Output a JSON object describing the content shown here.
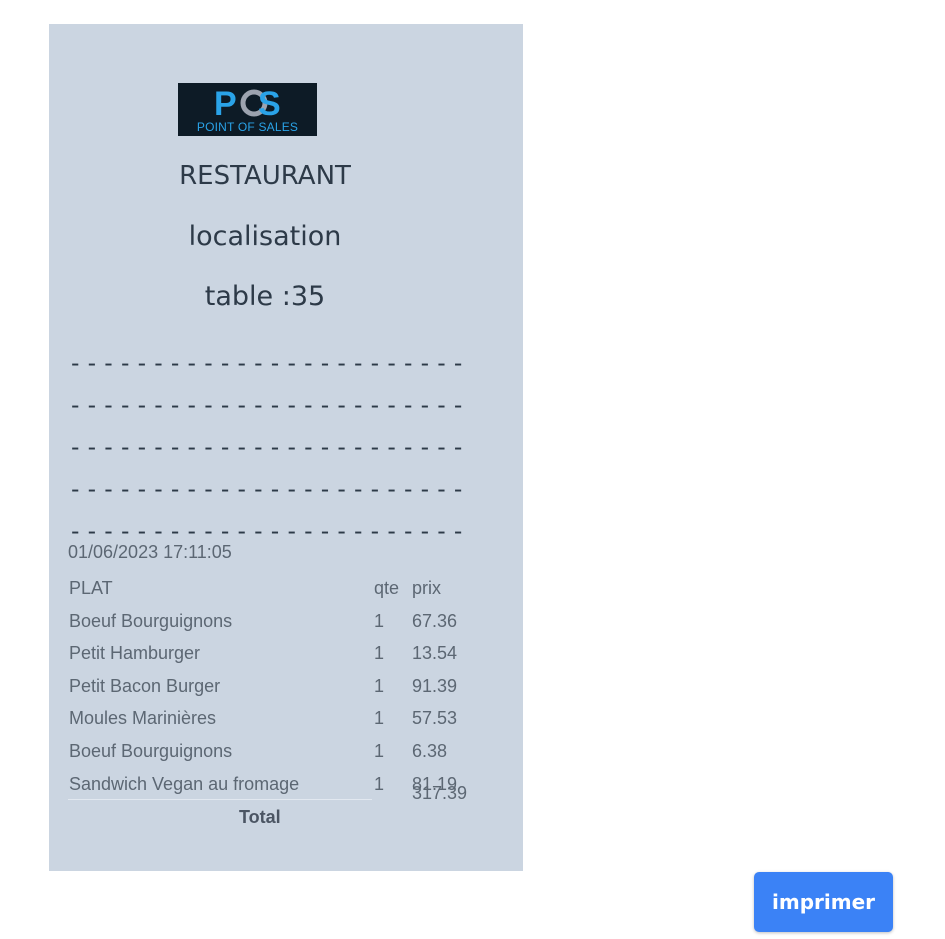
{
  "receipt": {
    "logo": {
      "mark": "POS",
      "text": "POINT OF SALES"
    },
    "title": "RESTAURANT",
    "location": "localisation",
    "table": "table :35",
    "separator": "------------------------------------------------------------------------------------------------------------------------",
    "datetime": "01/06/2023 17:11:05",
    "columns": {
      "plat": "PLAT",
      "qte": "qte",
      "prix": "prix"
    },
    "items": [
      {
        "plat": "Boeuf Bourguignons",
        "qte": "1",
        "prix": "67.36"
      },
      {
        "plat": "Petit Hamburger",
        "qte": "1",
        "prix": "13.54"
      },
      {
        "plat": "Petit Bacon Burger",
        "qte": "1",
        "prix": "91.39"
      },
      {
        "plat": "Moules Marinières",
        "qte": "1",
        "prix": "57.53"
      },
      {
        "plat": "Boeuf Bourguignons",
        "qte": "1",
        "prix": "6.38"
      },
      {
        "plat": "Sandwich Vegan au fromage",
        "qte": "1",
        "prix": "81.19"
      }
    ],
    "total_label": "Total",
    "total_value": "317.39"
  },
  "actions": {
    "print_label": "imprimer"
  },
  "colors": {
    "receipt_bg": "#cbd5e1",
    "button_bg": "#3b82f6",
    "logo_accent": "#2aa3e8"
  }
}
